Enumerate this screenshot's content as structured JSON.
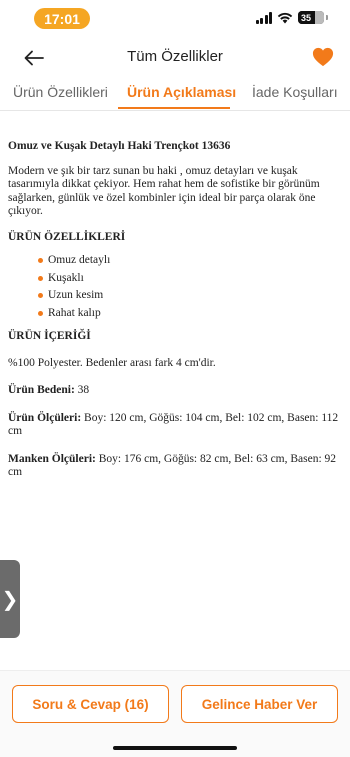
{
  "status_bar": {
    "time": "17:01",
    "battery": "35"
  },
  "header": {
    "title": "Tüm Özellikler",
    "back_icon": "arrow-left-icon",
    "favorite_icon": "heart-icon",
    "accent": "#f27a1a"
  },
  "tabs": [
    {
      "label": "Ürün Özellikleri",
      "active": false
    },
    {
      "label": "Ürün Açıklaması",
      "active": true
    },
    {
      "label": "İade Koşulları",
      "active": false
    }
  ],
  "content": {
    "title": "Omuz ve Kuşak Detaylı Haki Trençkot 13636",
    "description": "Modern ve şık bir tarz sunan bu haki , omuz detayları ve kuşak tasarımıyla dikkat çekiyor. Hem rahat hem de sofistike bir görünüm sağlarken, günlük ve özel kombinler için ideal bir parça olarak öne çıkıyor.",
    "features_heading": "ÜRÜN ÖZELLİKLERİ",
    "features": [
      "Omuz detaylı",
      "Kuşaklı",
      "Uzun kesim",
      "Rahat kalıp"
    ],
    "contents_heading": "ÜRÜN İÇERİĞİ",
    "contents_text": "%100 Polyester. Bedenler arası fark 4 cm'dir.",
    "size_label": "Ürün Bedeni:",
    "size_value": " 38",
    "product_measure_label": "Ürün Ölçüleri:",
    "product_measure_value": " Boy: 120 cm, Göğüs: 104 cm, Bel: 102 cm, Basen: 112 cm",
    "model_measure_label": "Manken Ölçüleri:",
    "model_measure_value": " Boy: 176 cm, Göğüs: 82 cm, Bel: 63 cm, Basen: 92 cm"
  },
  "side_handle": {
    "glyph": "❯"
  },
  "bottom_bar": {
    "qa_button": "Soru & Cevap (16)",
    "notify_button": "Gelince Haber Ver"
  }
}
